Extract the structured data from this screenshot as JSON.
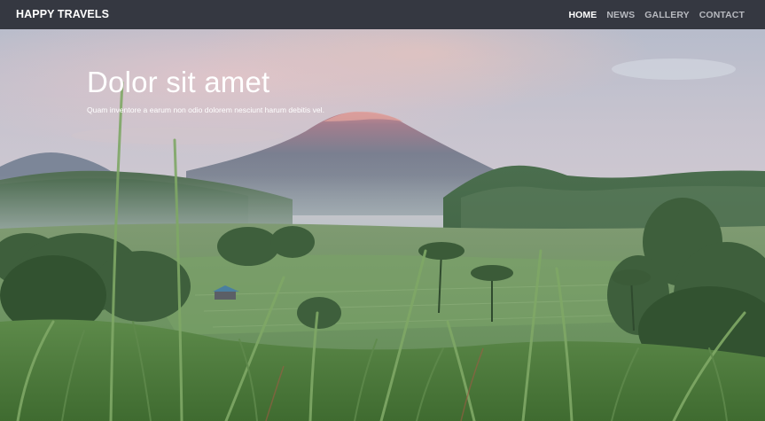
{
  "navbar": {
    "brand": "HAPPY TRAVELS",
    "links": [
      {
        "label": "HOME",
        "active": true
      },
      {
        "label": "NEWS",
        "active": false
      },
      {
        "label": "GALLERY",
        "active": false
      },
      {
        "label": "CONTACT",
        "active": false
      }
    ]
  },
  "hero": {
    "title": "Dolor sit amet",
    "subtitle": "Quam inventore a earum non odio dolorem nesciunt harum debitis vel."
  },
  "colors": {
    "navbar_bg": "#353841",
    "nav_active": "#ffffff",
    "nav_inactive": "#b7b9bf"
  }
}
